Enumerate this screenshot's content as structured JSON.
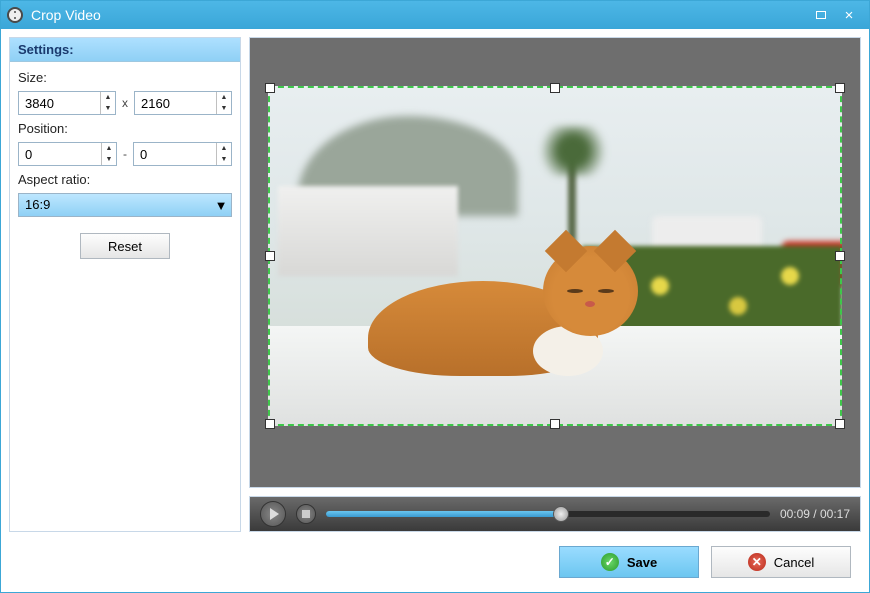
{
  "window": {
    "title": "Crop Video"
  },
  "settings": {
    "header": "Settings:",
    "size_label": "Size:",
    "size_w": "3840",
    "size_h": "2160",
    "size_sep": "x",
    "position_label": "Position:",
    "pos_x": "0",
    "pos_y": "0",
    "pos_sep": "-",
    "aspect_label": "Aspect ratio:",
    "aspect_value": "16:9",
    "reset_label": "Reset"
  },
  "playback": {
    "time": "00:09 / 00:17"
  },
  "footer": {
    "save_label": "Save",
    "cancel_label": "Cancel"
  }
}
